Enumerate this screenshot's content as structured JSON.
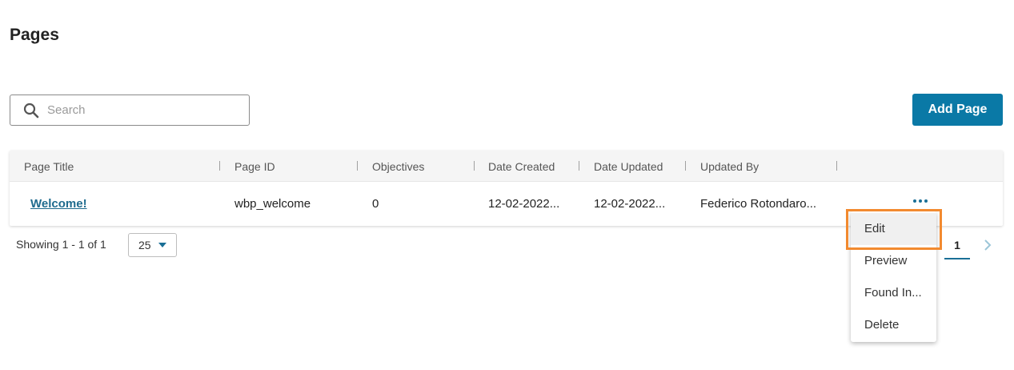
{
  "page": {
    "title": "Pages"
  },
  "search": {
    "placeholder": "Search",
    "value": ""
  },
  "toolbar": {
    "add_label": "Add Page"
  },
  "table": {
    "columns": [
      "Page Title",
      "Page ID",
      "Objectives",
      "Date Created",
      "Date Updated",
      "Updated By"
    ],
    "rows": [
      {
        "title": "Welcome!",
        "page_id": "wbp_welcome",
        "objectives": "0",
        "date_created": "12-02-2022...",
        "date_updated": "12-02-2022...",
        "updated_by": "Federico Rotondaro..."
      }
    ]
  },
  "footer": {
    "showing": "Showing 1 - 1 of 1",
    "per_page": "25",
    "current_page": "1"
  },
  "context_menu": {
    "items": [
      "Edit",
      "Preview",
      "Found In...",
      "Delete"
    ],
    "highlighted": "Edit"
  },
  "colors": {
    "accent": "#0a79a6",
    "link": "#1f6b8e",
    "highlight": "#f28a2f"
  },
  "icons": [
    "search-icon",
    "more-options-icon",
    "caret-down-icon",
    "chevron-right-icon"
  ]
}
